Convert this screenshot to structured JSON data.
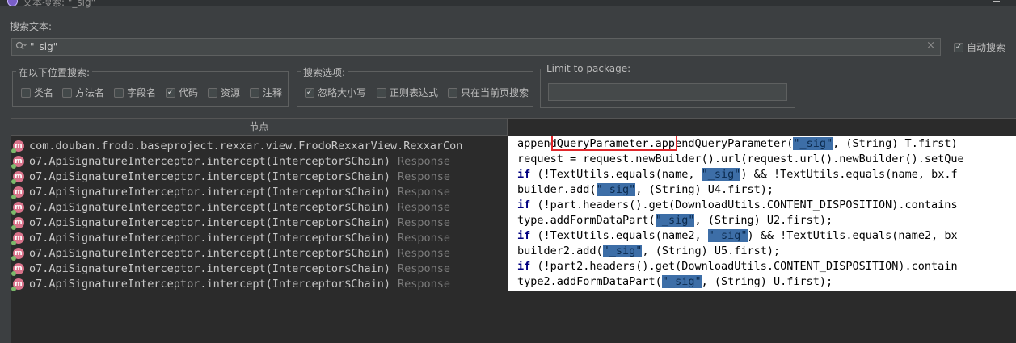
{
  "window": {
    "title": "文本搜索: \"_sig\""
  },
  "search": {
    "label": "搜索文本:",
    "value": "\"_sig\"",
    "clear_symbol": "×"
  },
  "auto_search": {
    "label": "自动搜索",
    "checked": true
  },
  "search_in": {
    "title": "在以下位置搜索:",
    "options": [
      {
        "label": "类名",
        "checked": false
      },
      {
        "label": "方法名",
        "checked": false
      },
      {
        "label": "字段名",
        "checked": false
      },
      {
        "label": "代码",
        "checked": true
      },
      {
        "label": "资源",
        "checked": false
      },
      {
        "label": "注释",
        "checked": false
      }
    ]
  },
  "search_options": {
    "title": "搜索选项:",
    "options": [
      {
        "label": "忽略大小写",
        "checked": true
      },
      {
        "label": "正则表达式",
        "checked": false
      },
      {
        "label": "只在当前页搜索",
        "checked": false
      }
    ]
  },
  "package_filter": {
    "title": "Limit to package:",
    "value": ""
  },
  "results": {
    "node_header": "节点",
    "nodes": [
      {
        "name": "com.douban.frodo.baseproject.rexxar.view.FrodoRexxarView.RexxarCon",
        "type": ""
      },
      {
        "name": "o7.ApiSignatureInterceptor.intercept(Interceptor$Chain)",
        "type": "Response"
      },
      {
        "name": "o7.ApiSignatureInterceptor.intercept(Interceptor$Chain)",
        "type": "Response"
      },
      {
        "name": "o7.ApiSignatureInterceptor.intercept(Interceptor$Chain)",
        "type": "Response"
      },
      {
        "name": "o7.ApiSignatureInterceptor.intercept(Interceptor$Chain)",
        "type": "Response"
      },
      {
        "name": "o7.ApiSignatureInterceptor.intercept(Interceptor$Chain)",
        "type": "Response"
      },
      {
        "name": "o7.ApiSignatureInterceptor.intercept(Interceptor$Chain)",
        "type": "Response"
      },
      {
        "name": "o7.ApiSignatureInterceptor.intercept(Interceptor$Chain)",
        "type": "Response"
      },
      {
        "name": "o7.ApiSignatureInterceptor.intercept(Interceptor$Chain)",
        "type": "Response"
      },
      {
        "name": "o7.ApiSignatureInterceptor.intercept(Interceptor$Chain)",
        "type": "Response"
      }
    ],
    "code_lines": [
      {
        "kw": "",
        "pre": "appendQueryParameter.appendQueryParameter(",
        "hl": "\"_sig\"",
        "post": ", (String) T.first)"
      },
      {
        "kw": "",
        "pre": "request = request.newBuilder().url(request.url().newBuilder().setQue",
        "hl": "",
        "post": ""
      },
      {
        "kw": "if",
        "pre": " (!TextUtils.equals(name, ",
        "hl": "\"_sig\"",
        "post": ") && !TextUtils.equals(name, bx.f"
      },
      {
        "kw": "",
        "pre": "builder.add(",
        "hl": "\"_sig\"",
        "post": ", (String) U4.first);"
      },
      {
        "kw": "if",
        "pre": " (!part.headers().get(DownloadUtils.CONTENT_DISPOSITION).contains",
        "hl": "",
        "post": ""
      },
      {
        "kw": "",
        "pre": "type.addFormDataPart(",
        "hl": "\"_sig\"",
        "post": ", (String) U2.first);"
      },
      {
        "kw": "if",
        "pre": " (!TextUtils.equals(name2, ",
        "hl": "\"_sig\"",
        "post": ") && !TextUtils.equals(name2, bx"
      },
      {
        "kw": "",
        "pre": "builder2.add(",
        "hl": "\"_sig\"",
        "post": ", (String) U5.first);"
      },
      {
        "kw": "if",
        "pre": " (!part2.headers().get(DownloadUtils.CONTENT_DISPOSITION).contain",
        "hl": "",
        "post": ""
      },
      {
        "kw": "",
        "pre": "type2.addFormDataPart(",
        "hl": "\"_sig\"",
        "post": ", (String) U.first);"
      }
    ]
  },
  "colors": {
    "highlight": "#3d6ea7",
    "annotation_box": "#e0262a",
    "method_icon": "#d9728a"
  },
  "icons": {
    "search": "search-icon",
    "clear": "close-icon",
    "method": "method-icon",
    "app": "app-icon"
  }
}
